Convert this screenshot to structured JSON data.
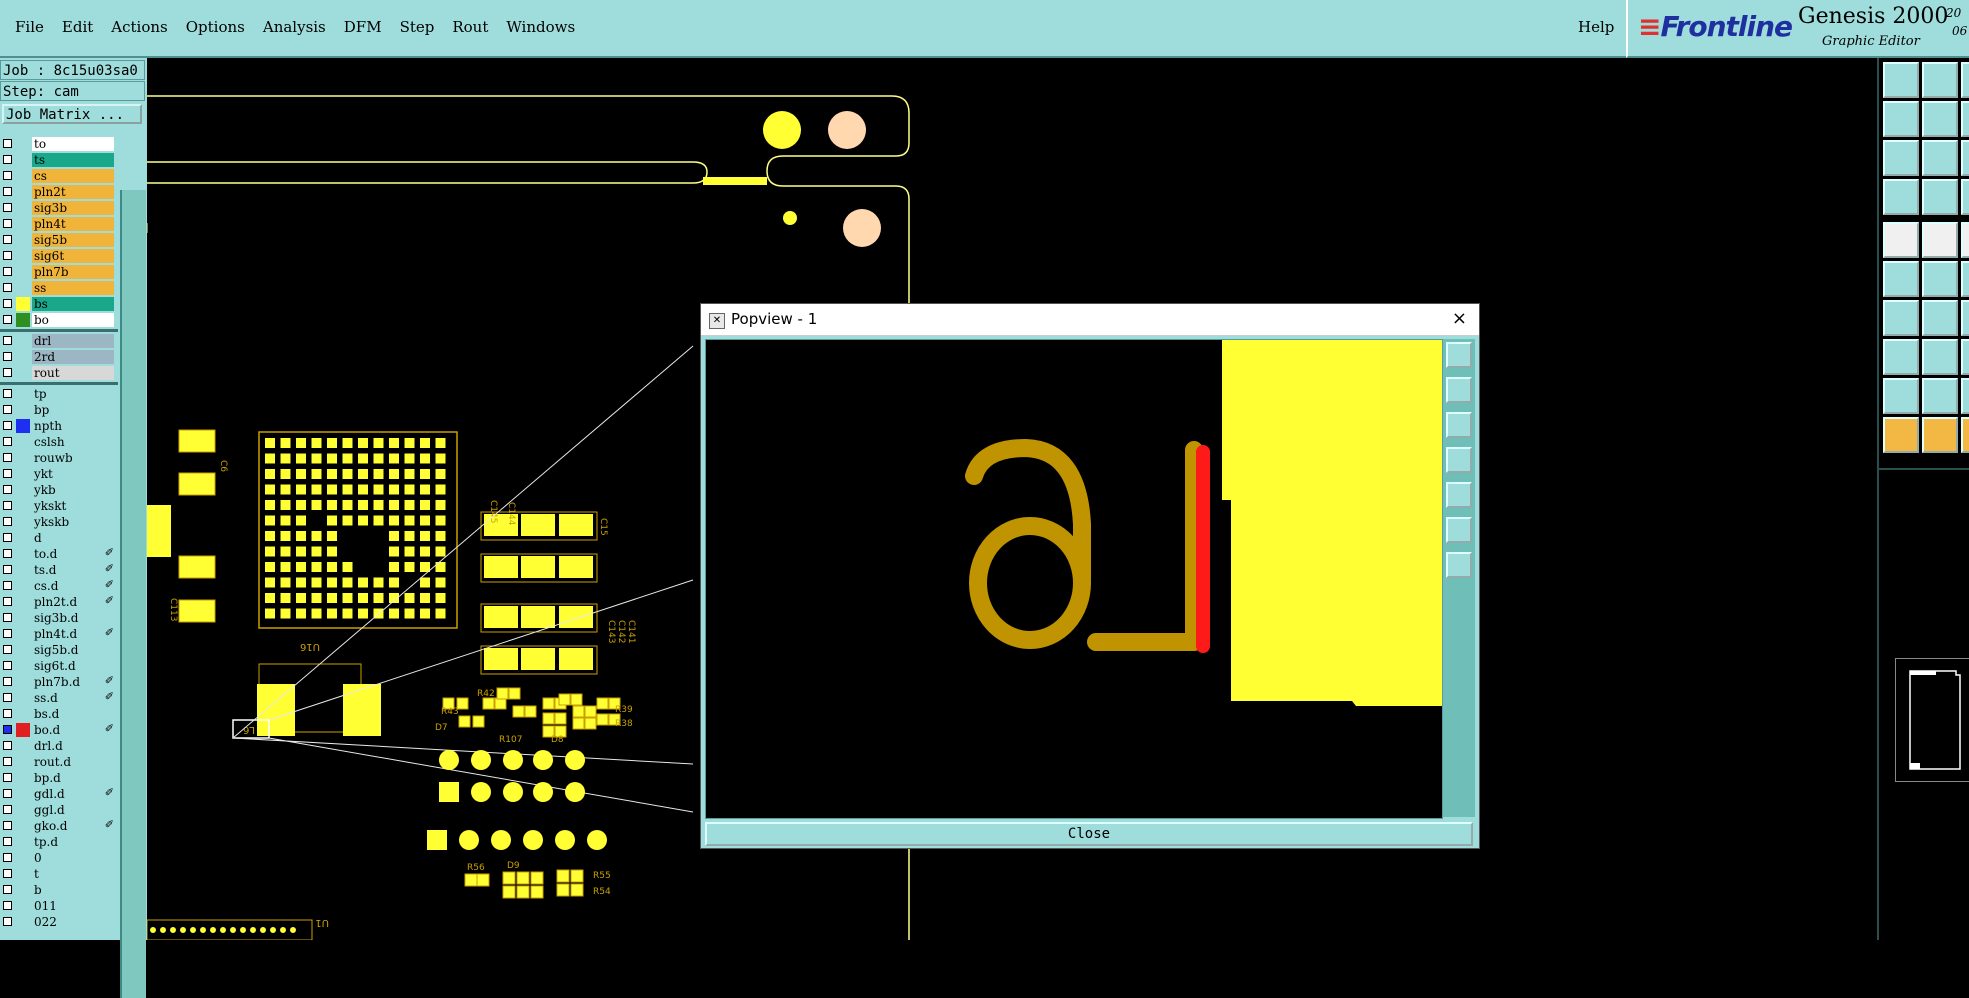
{
  "menu": {
    "items": [
      "File",
      "Edit",
      "Actions",
      "Options",
      "Analysis",
      "DFM",
      "Step",
      "Rout",
      "Windows"
    ],
    "help": "Help"
  },
  "brand": {
    "logo": "Frontline",
    "title": "Genesis 2000",
    "subtitle": "Graphic Editor",
    "date_top": "20",
    "date_bottom": "06"
  },
  "job": {
    "job_line": "Job : 8c15u03sa0",
    "step_line": "Step: cam",
    "matrix_button": "Job Matrix ..."
  },
  "layers": [
    {
      "name": "to",
      "bg": "#ffffff",
      "swatch": ""
    },
    {
      "name": "ts",
      "bg": "#1aa88a",
      "swatch": ""
    },
    {
      "name": "cs",
      "bg": "#f0b43a",
      "swatch": ""
    },
    {
      "name": "pln2t",
      "bg": "#f0b43a",
      "swatch": ""
    },
    {
      "name": "sig3b",
      "bg": "#f0b43a",
      "swatch": ""
    },
    {
      "name": "pln4t",
      "bg": "#f0b43a",
      "swatch": ""
    },
    {
      "name": "sig5b",
      "bg": "#f0b43a",
      "swatch": ""
    },
    {
      "name": "sig6t",
      "bg": "#f0b43a",
      "swatch": ""
    },
    {
      "name": "pln7b",
      "bg": "#f0b43a",
      "swatch": ""
    },
    {
      "name": "ss",
      "bg": "#f0b43a",
      "swatch": ""
    },
    {
      "name": "bs",
      "bg": "#1aa88a",
      "swatch": "#ffff33"
    },
    {
      "name": "bo",
      "bg": "#ffffff",
      "swatch": "#2f8f20"
    },
    {
      "name": "drl",
      "bg": "#9cb6c4",
      "swatch": "",
      "sep": true
    },
    {
      "name": "2rd",
      "bg": "#9cb6c4",
      "swatch": ""
    },
    {
      "name": "rout",
      "bg": "#d8d8d8",
      "swatch": ""
    },
    {
      "name": "tp",
      "bg": "#9fdcdc",
      "swatch": "",
      "sep": true
    },
    {
      "name": "bp",
      "bg": "#9fdcdc",
      "swatch": ""
    },
    {
      "name": "npth",
      "bg": "#9fdcdc",
      "swatch": "#1f2ff0"
    },
    {
      "name": "cslsh",
      "bg": "#9fdcdc",
      "swatch": ""
    },
    {
      "name": "rouwb",
      "bg": "#9fdcdc",
      "swatch": ""
    },
    {
      "name": "ykt",
      "bg": "#9fdcdc",
      "swatch": ""
    },
    {
      "name": "ykb",
      "bg": "#9fdcdc",
      "swatch": ""
    },
    {
      "name": "ykskt",
      "bg": "#9fdcdc",
      "swatch": ""
    },
    {
      "name": "ykskb",
      "bg": "#9fdcdc",
      "swatch": ""
    },
    {
      "name": "d",
      "bg": "#9fdcdc",
      "swatch": ""
    },
    {
      "name": "to.d",
      "bg": "#9fdcdc",
      "swatch": "",
      "edit": true
    },
    {
      "name": "ts.d",
      "bg": "#9fdcdc",
      "swatch": "",
      "edit": true
    },
    {
      "name": "cs.d",
      "bg": "#9fdcdc",
      "swatch": "",
      "edit": true
    },
    {
      "name": "pln2t.d",
      "bg": "#9fdcdc",
      "swatch": "",
      "edit": true
    },
    {
      "name": "sig3b.d",
      "bg": "#9fdcdc",
      "swatch": ""
    },
    {
      "name": "pln4t.d",
      "bg": "#9fdcdc",
      "swatch": "",
      "edit": true
    },
    {
      "name": "sig5b.d",
      "bg": "#9fdcdc",
      "swatch": ""
    },
    {
      "name": "sig6t.d",
      "bg": "#9fdcdc",
      "swatch": ""
    },
    {
      "name": "pln7b.d",
      "bg": "#9fdcdc",
      "swatch": "",
      "edit": true
    },
    {
      "name": "ss.d",
      "bg": "#9fdcdc",
      "swatch": "",
      "edit": true
    },
    {
      "name": "bs.d",
      "bg": "#9fdcdc",
      "swatch": ""
    },
    {
      "name": "bo.d",
      "bg": "#9fdcdc",
      "swatch": "#e02020",
      "edit": true,
      "active": true
    },
    {
      "name": "drl.d",
      "bg": "#9fdcdc",
      "swatch": ""
    },
    {
      "name": "rout.d",
      "bg": "#9fdcdc",
      "swatch": ""
    },
    {
      "name": "bp.d",
      "bg": "#9fdcdc",
      "swatch": ""
    },
    {
      "name": "gdl.d",
      "bg": "#9fdcdc",
      "swatch": "",
      "edit": true
    },
    {
      "name": "ggl.d",
      "bg": "#9fdcdc",
      "swatch": ""
    },
    {
      "name": "gko.d",
      "bg": "#9fdcdc",
      "swatch": "",
      "edit": true
    },
    {
      "name": "tp.d",
      "bg": "#9fdcdc",
      "swatch": ""
    },
    {
      "name": "0",
      "bg": "#9fdcdc",
      "swatch": ""
    },
    {
      "name": "t",
      "bg": "#9fdcdc",
      "swatch": ""
    },
    {
      "name": "b",
      "bg": "#9fdcdc",
      "swatch": ""
    },
    {
      "name": "011",
      "bg": "#9fdcdc",
      "swatch": ""
    },
    {
      "name": "022",
      "bg": "#9fdcdc",
      "swatch": ""
    }
  ],
  "board_labels": {
    "u16": "U16",
    "u1": "U1",
    "r43": "R43",
    "d7": "D7",
    "r42": "R42",
    "r107": "R107",
    "d8": "D8",
    "r39": "R39",
    "r38": "R38",
    "r56": "R56",
    "d9": "D9",
    "r55": "R55",
    "r54": "R54",
    "c141": "C141",
    "c142": "C142",
    "c143": "C143",
    "c144": "C144",
    "c145": "C145",
    "c15": "C15",
    "c113": "C113",
    "c6": "C6",
    "l6": "L6"
  },
  "popview": {
    "title": "Popview - 1",
    "close_x": "×",
    "close_button": "Close",
    "zoom_text": "L6"
  },
  "colors": {
    "panel": "#9fdcdc",
    "copper": "#ffff33",
    "silk": "#c8a000",
    "highlight": "#ff1a1a"
  }
}
